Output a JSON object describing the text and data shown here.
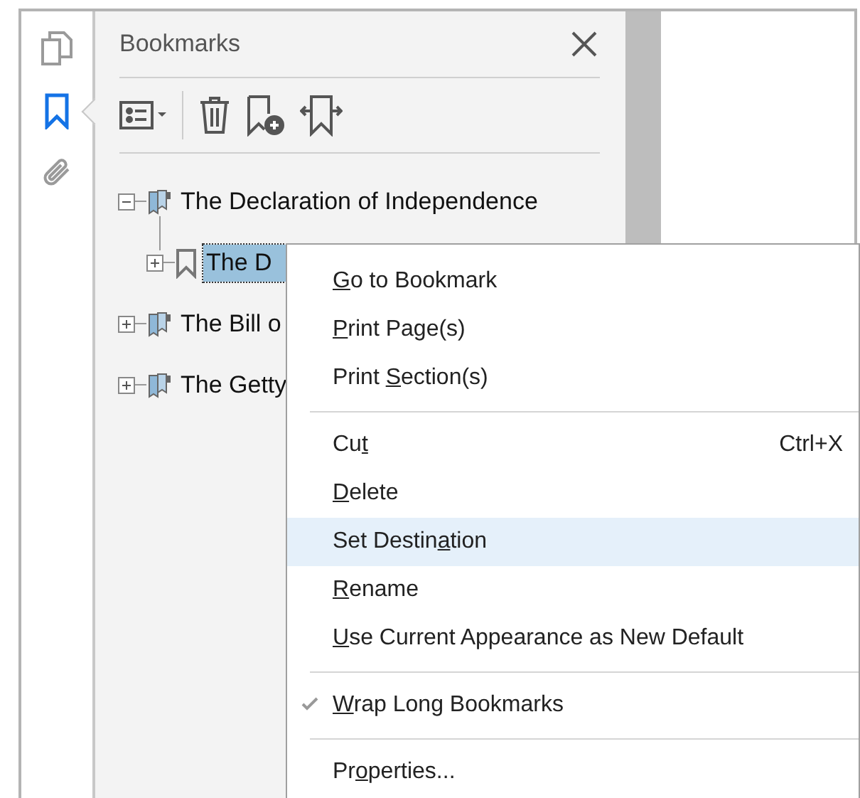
{
  "sidebar": {
    "buttons": [
      {
        "kind": "pages",
        "selected": false
      },
      {
        "kind": "bookmarks",
        "selected": true
      },
      {
        "kind": "attachments",
        "selected": false
      }
    ]
  },
  "panel": {
    "title": "Bookmarks"
  },
  "tree": [
    {
      "label": "The Declaration of Independence",
      "kind": "section",
      "expanded": true,
      "selected": false,
      "children": [
        {
          "label": "The D",
          "kind": "bookmark",
          "expanded": false,
          "selected": true
        }
      ]
    },
    {
      "label": "The Bill o",
      "kind": "section",
      "expanded": false,
      "selected": false
    },
    {
      "label": "The Getty",
      "kind": "section",
      "expanded": false,
      "selected": false
    }
  ],
  "context_menu": [
    {
      "kind": "item",
      "key": "G",
      "after": "o to Bookmark",
      "selected": false,
      "checked": false
    },
    {
      "kind": "item",
      "key": "P",
      "after": "rint Page(s)",
      "selected": false,
      "checked": false
    },
    {
      "kind": "item",
      "before": "Print ",
      "key": "S",
      "after": "ection(s)",
      "selected": false,
      "checked": false
    },
    {
      "kind": "separator"
    },
    {
      "kind": "item",
      "before": "Cu",
      "key": "t",
      "shortcut": "Ctrl+X",
      "selected": false,
      "checked": false
    },
    {
      "kind": "item",
      "key": "D",
      "after": "elete",
      "selected": false,
      "checked": false
    },
    {
      "kind": "item",
      "before": "Set Destin",
      "key": "a",
      "after": "tion",
      "selected": true,
      "checked": false
    },
    {
      "kind": "item",
      "key": "R",
      "after": "ename",
      "selected": false,
      "checked": false
    },
    {
      "kind": "item",
      "key": "U",
      "after": "se Current Appearance as New Default",
      "selected": false,
      "checked": false
    },
    {
      "kind": "separator"
    },
    {
      "kind": "item",
      "key": "W",
      "after": "rap Long Bookmarks",
      "selected": false,
      "checked": true
    },
    {
      "kind": "separator"
    },
    {
      "kind": "item",
      "before": "Pr",
      "key": "o",
      "after": "perties...",
      "selected": false,
      "checked": false
    }
  ]
}
